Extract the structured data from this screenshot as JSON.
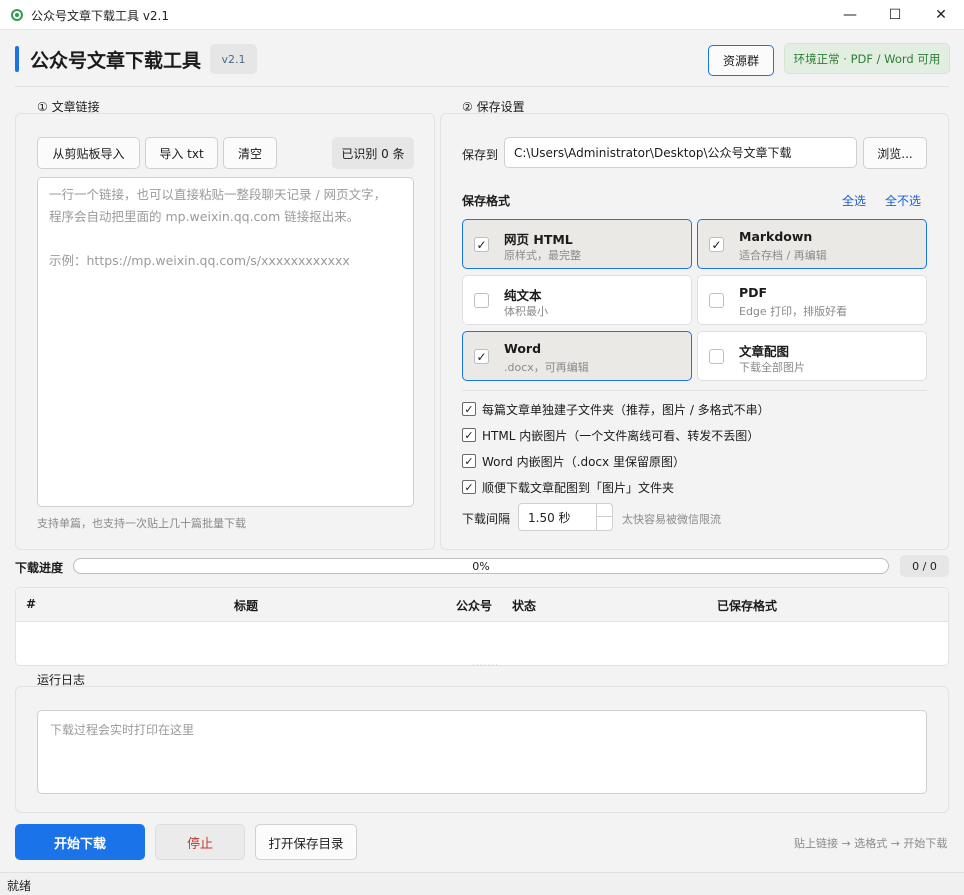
{
  "window": {
    "title": "公众号文章下载工具   v2.1",
    "min_glyph": "—",
    "max_glyph": "☐",
    "close_glyph": "✕"
  },
  "header": {
    "title": "公众号文章下载工具",
    "version": "v2.1",
    "resource_button": "资源群",
    "env_status": "环境正常 · PDF / Word 可用",
    "accent_color": "#1a73e8",
    "env_color": "#2e7d32"
  },
  "links_section": {
    "label": "① 文章链接",
    "buttons": {
      "paste": "从剪贴板导入",
      "import_txt": "导入 txt",
      "clear": "清空"
    },
    "recognized": "已识别 0 条",
    "placeholder": "一行一个链接，也可以直接粘贴一整段聊天记录 / 网页文字，\n程序会自动把里面的 mp.weixin.qq.com 链接抠出来。\n\n示例：https://mp.weixin.qq.com/s/xxxxxxxxxxxx",
    "hint": "支持单篇，也支持一次贴上几十篇批量下载"
  },
  "save_section": {
    "label": "② 保存设置",
    "save_to_label": "保存到",
    "save_path": "C:\\Users\\Administrator\\Desktop\\公众号文章下载",
    "browse": "浏览...",
    "formats_label": "保存格式",
    "select_all": "全选",
    "select_none": "全不选",
    "formats": [
      {
        "name": "网页 HTML",
        "desc": "原样式，最完整",
        "checked": true
      },
      {
        "name": "Markdown",
        "desc": "适合存档 / 再编辑",
        "checked": true
      },
      {
        "name": "纯文本",
        "desc": "体积最小",
        "checked": false
      },
      {
        "name": "PDF",
        "desc": "Edge 打印，排版好看",
        "checked": false
      },
      {
        "name": "Word",
        "desc": ".docx，可再编辑",
        "checked": true
      },
      {
        "name": "文章配图",
        "desc": "下载全部图片",
        "checked": false
      }
    ],
    "options": [
      {
        "label": "每篇文章单独建子文件夹（推荐，图片 / 多格式不串）",
        "checked": true
      },
      {
        "label": "HTML 内嵌图片（一个文件离线可看、转发不丢图）",
        "checked": true
      },
      {
        "label": "Word 内嵌图片（.docx 里保留原图）",
        "checked": true
      },
      {
        "label": "顺便下载文章配图到「图片」文件夹",
        "checked": true
      }
    ],
    "interval_label": "下载间隔",
    "interval_value": "1.50 秒",
    "interval_hint": "太快容易被微信限流"
  },
  "progress": {
    "label": "下载进度",
    "percent_text": "0%",
    "percent": 0,
    "count": "0 / 0"
  },
  "table": {
    "columns": [
      "#",
      "标题",
      "公众号",
      "状态",
      "已保存格式"
    ],
    "rows": []
  },
  "log": {
    "label": "运行日志",
    "placeholder": "下载过程会实时打印在这里"
  },
  "actions": {
    "start": "开始下载",
    "stop": "停止",
    "open_dir": "打开保存目录",
    "flow_hint": "贴上链接 → 选格式 → 开始下载"
  },
  "status": {
    "text": "就绪"
  },
  "check_glyph": "✓"
}
